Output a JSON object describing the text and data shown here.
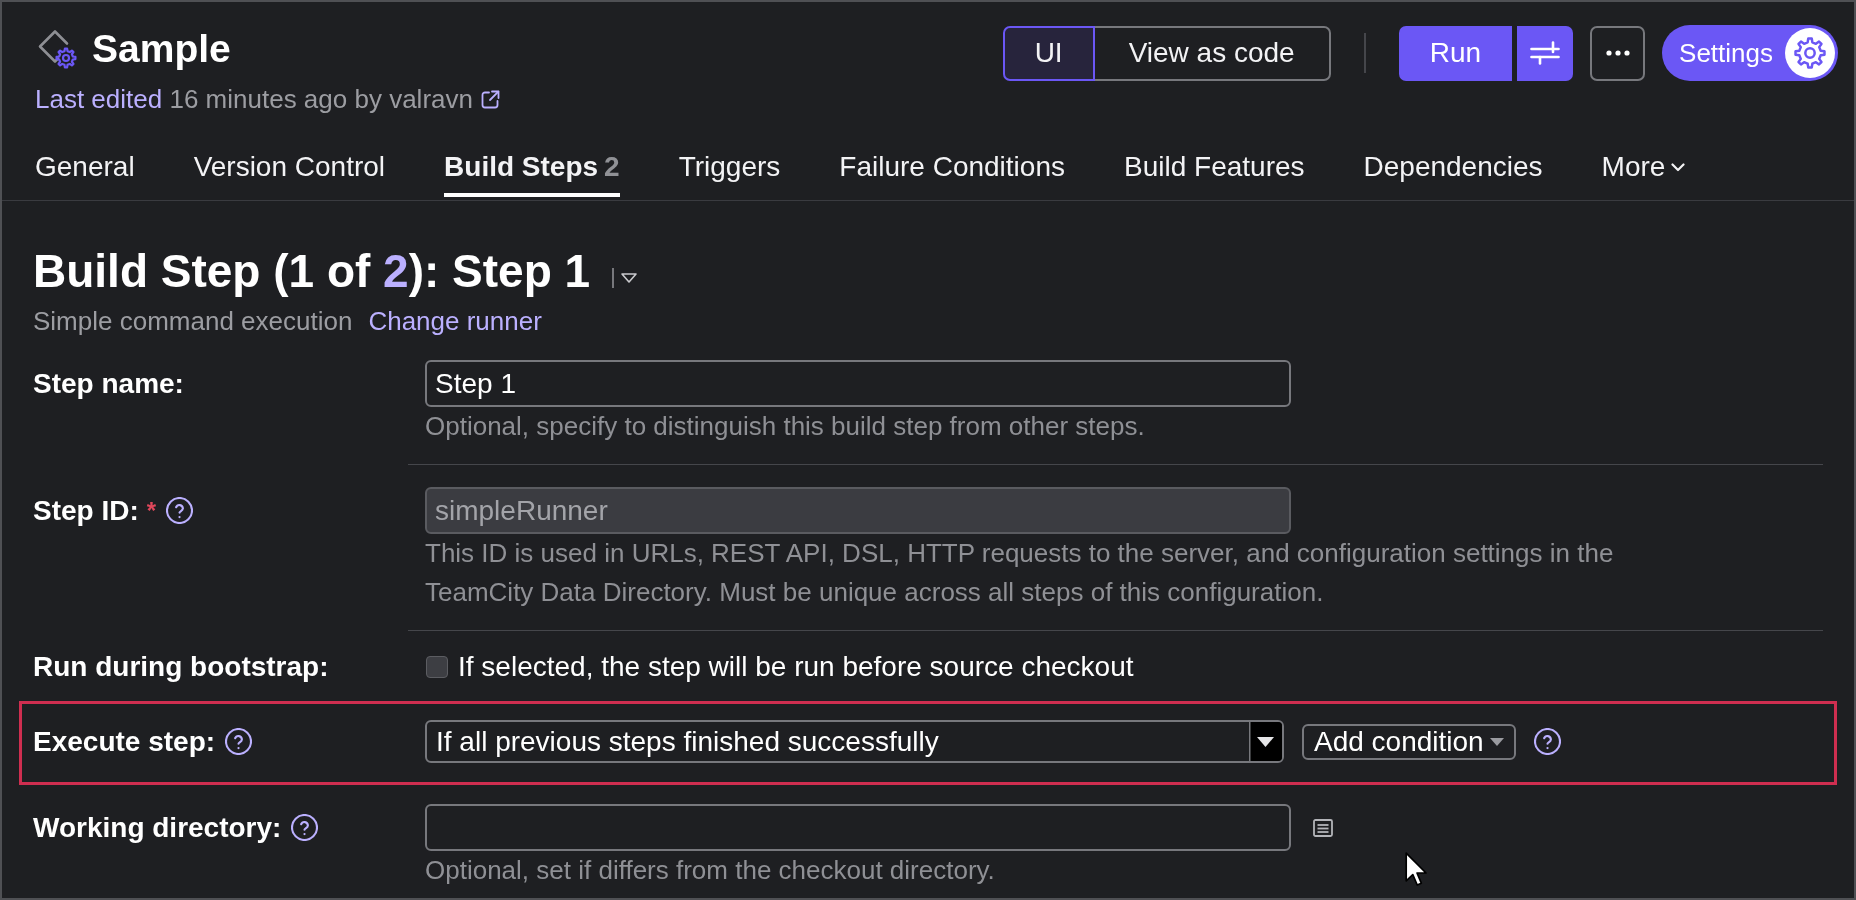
{
  "header": {
    "title": "Sample",
    "last_edited": {
      "link": "Last edited",
      "text": "16 minutes ago by valravn"
    }
  },
  "view_modes": [
    {
      "label": "UI",
      "selected": true
    },
    {
      "label": "View as code",
      "selected": false
    }
  ],
  "run_button": {
    "label": "Run"
  },
  "settings_button": {
    "label": "Settings"
  },
  "tabs": [
    {
      "kind": "tab",
      "label": "General",
      "selected": false
    },
    {
      "kind": "tab",
      "label": "Version Control",
      "selected": false
    },
    {
      "kind": "tab",
      "label": "Build Steps",
      "count": "2",
      "selected": true
    },
    {
      "kind": "tab",
      "label": "Triggers",
      "selected": false
    },
    {
      "kind": "tab",
      "label": "Failure Conditions",
      "selected": false
    },
    {
      "kind": "tab",
      "label": "Build Features",
      "selected": false
    },
    {
      "kind": "tab",
      "label": "Dependencies",
      "selected": false
    },
    {
      "kind": "menu",
      "label": "More",
      "selected": false
    }
  ],
  "step": {
    "title_start": "Build Step (1 of ",
    "title_link": "2",
    "title_end": "): Step 1",
    "runner": "Simple command execution",
    "change_runner": "Change runner"
  },
  "fields": [
    {
      "kind": "text",
      "label": "Step name:",
      "help": false,
      "value": "Step 1",
      "disabled": false,
      "hint": "Optional, specify to distinguish this build step from other steps.",
      "divider_after": true,
      "highlighted": false
    },
    {
      "kind": "text",
      "label": "Step ID:",
      "required_mark": "*",
      "help": true,
      "value": "simpleRunner",
      "disabled": true,
      "hint": "This ID is used in URLs, REST API, DSL, HTTP requests to the server, and configuration settings in the TeamCity Data Directory. Must be unique across all steps of this configuration.",
      "divider_after": true,
      "highlighted": false
    },
    {
      "kind": "checkbox",
      "label": "Run during bootstrap:",
      "help": false,
      "checked": false,
      "text": "If selected, the step will be run before source checkout",
      "divider_after": false,
      "highlighted": false
    },
    {
      "kind": "select",
      "label": "Execute step:",
      "help": true,
      "value": "If all previous steps finished successfully",
      "button": "Add condition",
      "button_help": true,
      "divider_after": false,
      "highlighted": true
    },
    {
      "kind": "path",
      "label": "Working directory:",
      "help": true,
      "disabled": false,
      "hint": "Optional, set if differs from the checkout directory.",
      "divider_after": false,
      "highlighted": false
    }
  ]
}
